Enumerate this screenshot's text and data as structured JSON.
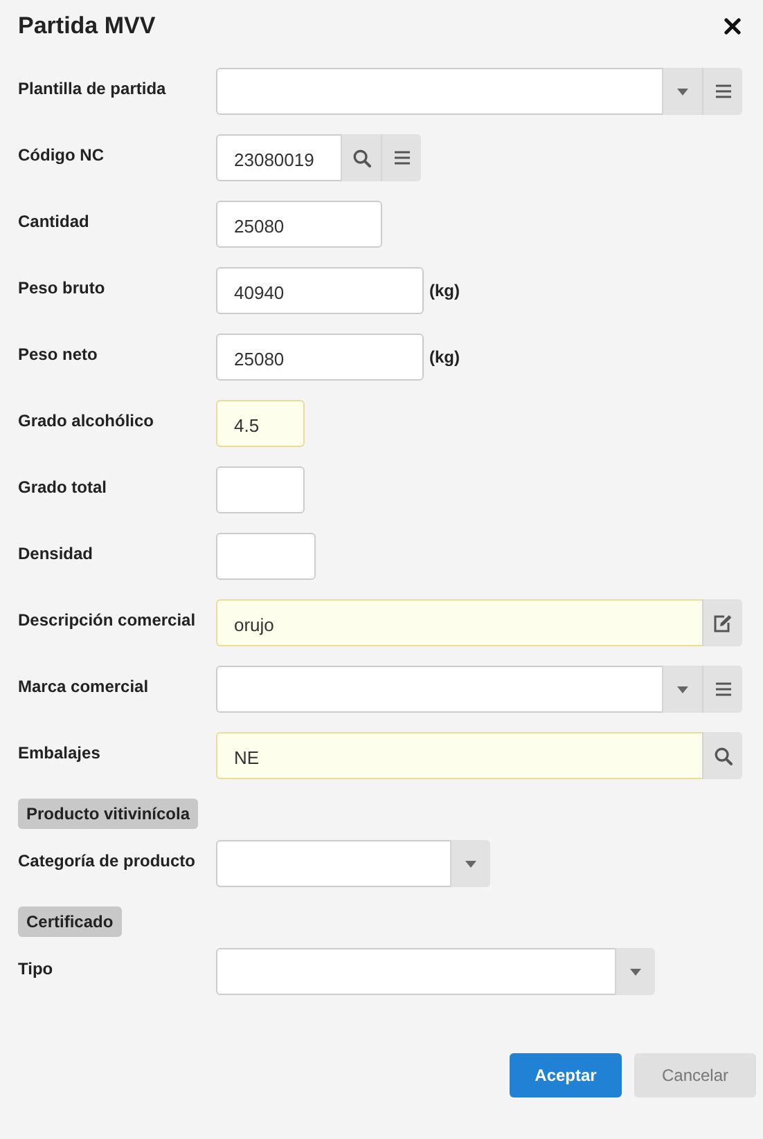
{
  "dialog": {
    "title": "Partida MVV"
  },
  "rows": [
    {
      "kind": "field",
      "label": "Plantilla de partida",
      "value": "",
      "required": false,
      "addons": [
        {
          "kind": "dropdown"
        },
        {
          "kind": "menu"
        }
      ]
    },
    {
      "kind": "field",
      "label": "Código NC",
      "value": "23080019",
      "required": false,
      "addons": [
        {
          "kind": "search"
        },
        {
          "kind": "menu"
        }
      ]
    },
    {
      "kind": "field",
      "label": "Cantidad",
      "value": "25080",
      "required": false,
      "addons": []
    },
    {
      "kind": "field",
      "label": "Peso bruto",
      "value": "40940",
      "required": false,
      "addons": [],
      "unit": "(kg)"
    },
    {
      "kind": "field",
      "label": "Peso neto",
      "value": "25080",
      "required": false,
      "addons": [],
      "unit": "(kg)"
    },
    {
      "kind": "field",
      "label": "Grado alcohólico",
      "value": "4.5",
      "required": true,
      "addons": []
    },
    {
      "kind": "field",
      "label": "Grado total",
      "value": "",
      "required": false,
      "addons": []
    },
    {
      "kind": "field",
      "label": "Densidad",
      "value": "",
      "required": false,
      "addons": []
    },
    {
      "kind": "field",
      "label": "Descripción comercial",
      "value": "orujo",
      "required": true,
      "addons": [
        {
          "kind": "edit"
        }
      ]
    },
    {
      "kind": "field",
      "label": "Marca comercial",
      "value": "",
      "required": false,
      "addons": [
        {
          "kind": "dropdown"
        },
        {
          "kind": "menu"
        }
      ]
    },
    {
      "kind": "field",
      "label": "Embalajes",
      "value": "NE",
      "required": true,
      "addons": [
        {
          "kind": "search"
        }
      ]
    },
    {
      "kind": "section",
      "label": "Producto vitivinícola"
    },
    {
      "kind": "field",
      "label": "Categoría de producto",
      "value": "",
      "required": false,
      "addons": [
        {
          "kind": "dropdown"
        }
      ]
    },
    {
      "kind": "section",
      "label": "Certificado"
    },
    {
      "kind": "field",
      "label": "Tipo",
      "value": "",
      "required": false,
      "addons": [
        {
          "kind": "dropdown"
        }
      ]
    }
  ],
  "buttons": [
    {
      "label": "Aceptar",
      "kind": "primary"
    },
    {
      "label": "Cancelar",
      "kind": "secondary"
    }
  ]
}
